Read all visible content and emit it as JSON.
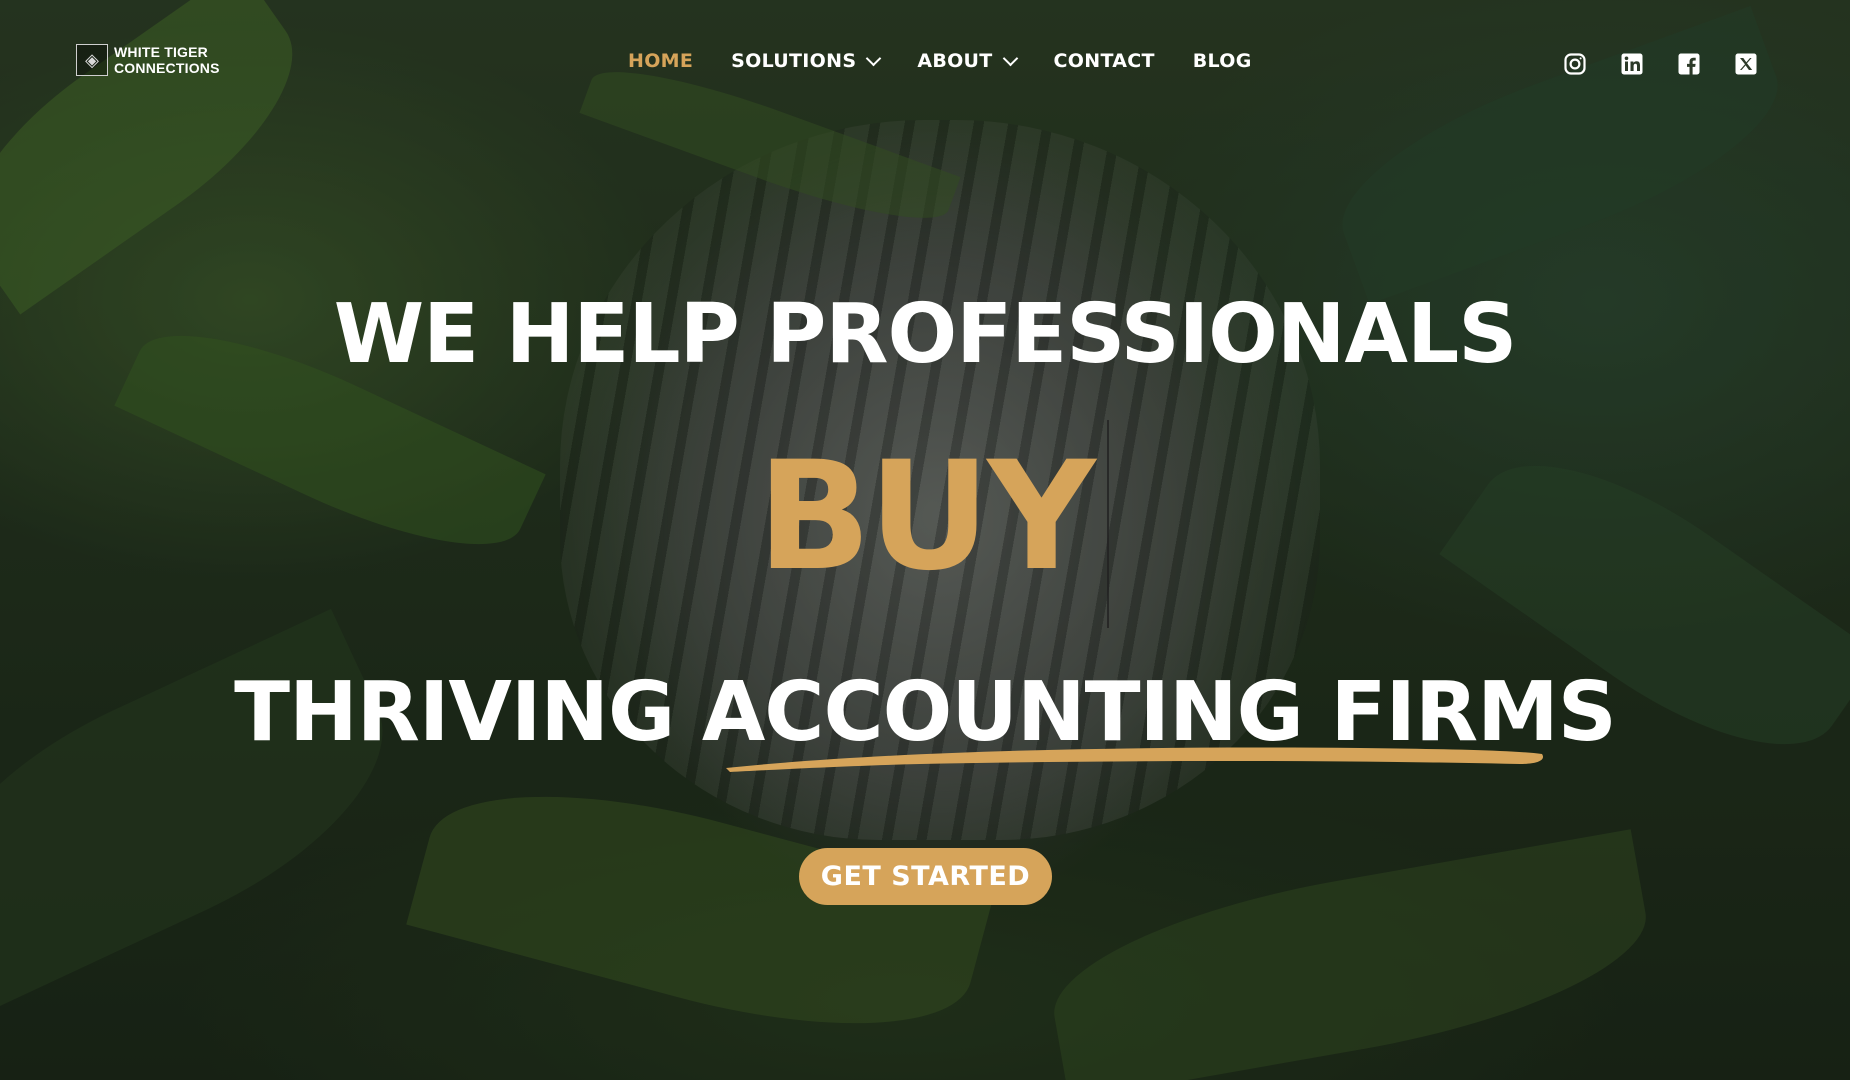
{
  "brand": {
    "name_line1": "WHITE TIGER",
    "name_line2": "CONNECTIONS"
  },
  "nav": {
    "items": [
      {
        "label": "HOME",
        "active": true,
        "dropdown": false
      },
      {
        "label": "SOLUTIONS",
        "active": false,
        "dropdown": true
      },
      {
        "label": "ABOUT",
        "active": false,
        "dropdown": true
      },
      {
        "label": "CONTACT",
        "active": false,
        "dropdown": false
      },
      {
        "label": "BLOG",
        "active": false,
        "dropdown": false
      }
    ]
  },
  "social": [
    {
      "icon": "instagram-icon"
    },
    {
      "icon": "linkedin-icon"
    },
    {
      "icon": "facebook-icon"
    },
    {
      "icon": "x-twitter-icon"
    }
  ],
  "hero": {
    "line1": "WE HELP PROFESSIONALS",
    "rotating_word": "BUY",
    "line3": "THRIVING ACCOUNTING FIRMS",
    "cta_label": "GET STARTED"
  },
  "colors": {
    "accent": "#d6a45a",
    "text": "#ffffff"
  }
}
